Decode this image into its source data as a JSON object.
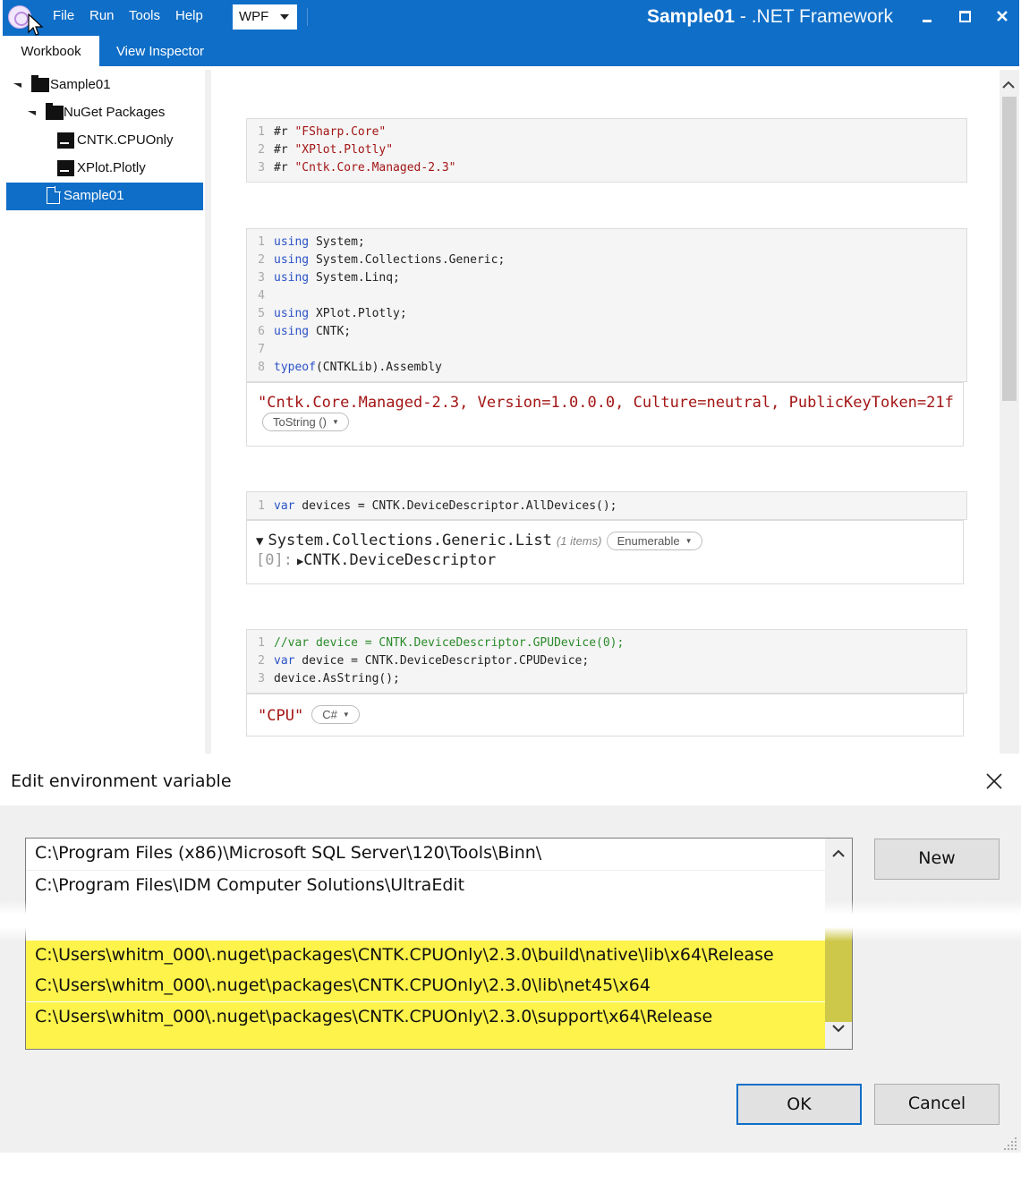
{
  "title_bar": {
    "menu": [
      "File",
      "Run",
      "Tools",
      "Help"
    ],
    "platform": "WPF",
    "title_name": "Sample01",
    "title_suffix": " - .NET Framework"
  },
  "tabs": [
    "Workbook",
    "View Inspector"
  ],
  "sidebar": {
    "items": [
      {
        "label": "Sample01"
      },
      {
        "label": "NuGet Packages"
      },
      {
        "label": "CNTK.CPUOnly"
      },
      {
        "label": "XPlot.Plotly"
      },
      {
        "label": "Sample01"
      }
    ]
  },
  "cells": {
    "c1": {
      "lines": [
        {
          "n": "1",
          "kw": "#r ",
          "str": "\"FSharp.Core\""
        },
        {
          "n": "2",
          "kw": "#r ",
          "str": "\"XPlot.Plotly\""
        },
        {
          "n": "3",
          "kw": "#r ",
          "str": "\"Cntk.Core.Managed-2.3\""
        }
      ]
    },
    "c2": {
      "lines": [
        {
          "n": "1",
          "kw": "using",
          "text": " System;"
        },
        {
          "n": "2",
          "kw": "using",
          "text": " System.Collections.Generic;"
        },
        {
          "n": "3",
          "kw": "using",
          "text": " System.Linq;"
        },
        {
          "n": "4",
          "kw": "",
          "text": ""
        },
        {
          "n": "5",
          "kw": "using",
          "text": " XPlot.Plotly;"
        },
        {
          "n": "6",
          "kw": "using",
          "text": " CNTK;"
        },
        {
          "n": "7",
          "kw": "",
          "text": ""
        },
        {
          "n": "8",
          "kw": "typeof",
          "text": "(CNTKLib).Assembly"
        }
      ],
      "result": "\"Cntk.Core.Managed-2.3, Version=1.0.0.0, Culture=neutral, PublicKeyToken=21f",
      "result_button": "ToString ()"
    },
    "c3": {
      "lines": [
        {
          "n": "1",
          "kw": "var",
          "text": " devices = CNTK.DeviceDescriptor.AllDevices();"
        }
      ],
      "result_type": "System.Collections.Generic.List",
      "result_count": "(1 items)",
      "result_button": "Enumerable",
      "result_index": "[0]:",
      "result_item": "CNTK.DeviceDescriptor"
    },
    "c4": {
      "lines": [
        {
          "n": "1",
          "kw": "",
          "comment": "//var device = CNTK.DeviceDescriptor.GPUDevice(0);"
        },
        {
          "n": "2",
          "kw": "var",
          "text": " device = CNTK.DeviceDescriptor.CPUDevice;"
        },
        {
          "n": "3",
          "kw": "",
          "text": "device.AsString();"
        }
      ],
      "result": "\"CPU\"",
      "result_button": "C#"
    }
  },
  "dialog": {
    "title": "Edit environment variable",
    "paths_top": [
      "C:\\Program Files (x86)\\Microsoft SQL Server\\120\\Tools\\Binn\\",
      "C:\\Program Files\\IDM Computer Solutions\\UltraEdit"
    ],
    "paths_highlighted": [
      "C:\\Users\\whitm_000\\.nuget\\packages\\CNTK.CPUOnly\\2.3.0\\build\\native\\lib\\x64\\Release",
      "C:\\Users\\whitm_000\\.nuget\\packages\\CNTK.CPUOnly\\2.3.0\\lib\\net45\\x64",
      "C:\\Users\\whitm_000\\.nuget\\packages\\CNTK.CPUOnly\\2.3.0\\support\\x64\\Release"
    ],
    "new_label": "New",
    "ok_label": "OK",
    "cancel_label": "Cancel"
  },
  "colors": {
    "accent": "#0f6ec7",
    "highlight": "#fdf34a",
    "string": "#a31515",
    "keyword": "#2a52c7",
    "comment": "#2a8a2a"
  }
}
